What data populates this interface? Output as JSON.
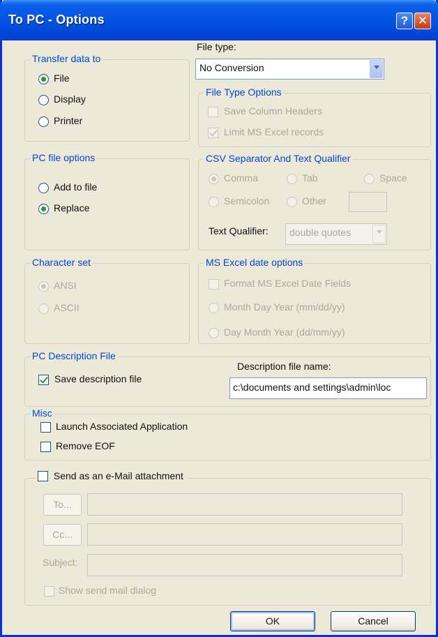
{
  "window": {
    "title": "To PC - Options",
    "help_glyph": "?",
    "close_glyph": "✕"
  },
  "transfer": {
    "legend": "Transfer data to",
    "options": [
      {
        "label": "File",
        "checked": true
      },
      {
        "label": "Display",
        "checked": false
      },
      {
        "label": "Printer",
        "checked": false
      }
    ]
  },
  "file_type": {
    "label": "File type:",
    "value": "No Conversion"
  },
  "file_type_options": {
    "legend": "File Type Options",
    "save_column_headers": "Save Column Headers",
    "limit_excel": "Limit MS Excel records"
  },
  "pc_file_options": {
    "legend": "PC file options",
    "add_to_file": "Add to file",
    "replace": "Replace"
  },
  "csv": {
    "legend": "CSV Separator And Text Qualifier",
    "comma": "Comma",
    "tab": "Tab",
    "space": "Space",
    "semicolon": "Semicolon",
    "other": "Other",
    "text_qualifier_label": "Text Qualifier:",
    "text_qualifier_value": "double quotes"
  },
  "charset": {
    "legend": "Character set",
    "ansi": "ANSI",
    "ascii": "ASCII"
  },
  "excel_date": {
    "legend": "MS Excel date options",
    "format": "Format MS Excel Date Fields",
    "mdy": "Month Day Year (mm/dd/yy)",
    "dmy": "Day Month Year (dd/mm/yy)"
  },
  "description": {
    "legend": "PC Description File",
    "save": "Save description file",
    "name_label": "Description file name:",
    "name_value": "c:\\documents and settings\\admin\\loc"
  },
  "misc": {
    "legend": "Misc",
    "launch": "Launch Associated Application",
    "remove_eof": "Remove EOF"
  },
  "email": {
    "legend": "Send as an e-Mail attachment",
    "to": "To...",
    "cc": "Cc...",
    "subject": "Subject:",
    "show_dialog": "Show send mail dialog"
  },
  "buttons": {
    "ok": "OK",
    "cancel": "Cancel"
  }
}
